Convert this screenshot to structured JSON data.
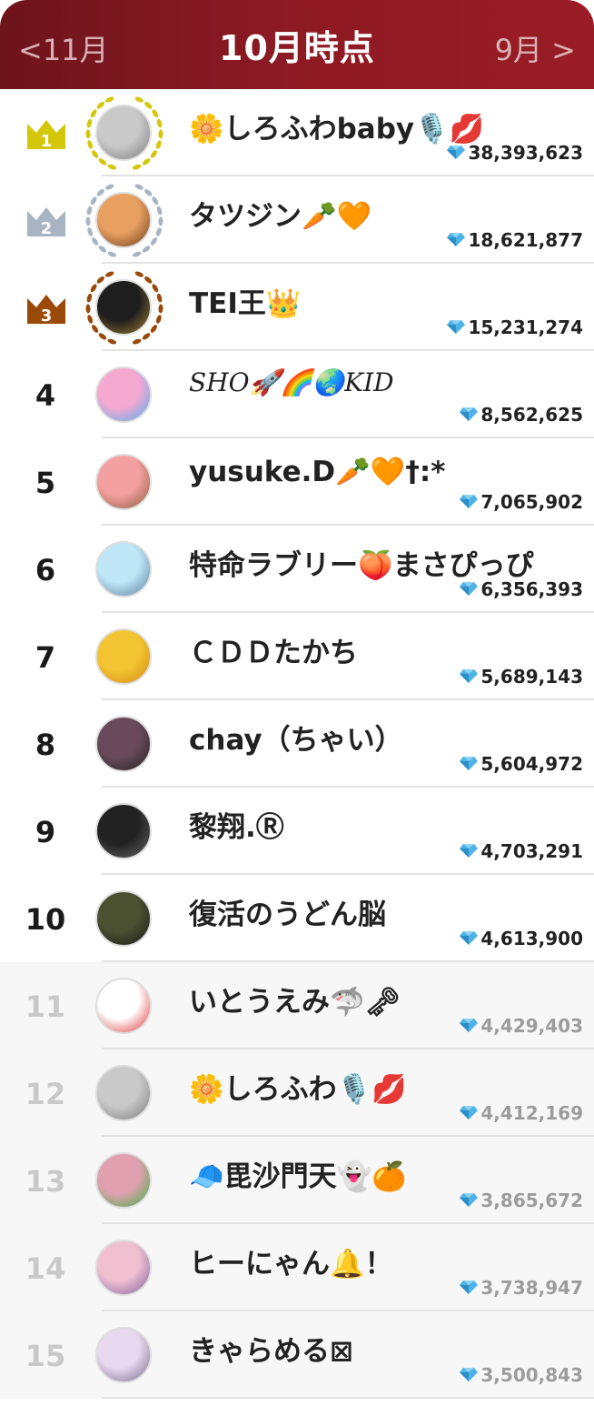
{
  "header": {
    "title": "10月時点",
    "prev_label": "<11月",
    "next_label": "9月 >"
  },
  "colors": {
    "header_bg": "#8e1a24",
    "gold": "#d4c70a",
    "silver": "#a9b4c2",
    "bronze": "#9a4a08",
    "gem": "#4fb2e6"
  },
  "icons": {
    "score": "diamond-icon",
    "rank_badge": "crown-icon"
  },
  "rankings": [
    {
      "rank": "1",
      "name": "🌼しろふわbaby🎙️💋",
      "score": "38,393,623"
    },
    {
      "rank": "2",
      "name": "タツジン🥕🧡",
      "score": "18,621,877"
    },
    {
      "rank": "3",
      "name": "TEI王👑",
      "score": "15,231,274"
    },
    {
      "rank": "4",
      "name": "SHO🚀🌈🌏KID",
      "score": "8,562,625"
    },
    {
      "rank": "5",
      "name": "yusuke.D🥕🧡†:*",
      "score": "7,065,902"
    },
    {
      "rank": "6",
      "name": "特命ラブリー🍑まさぴっぴ",
      "score": "6,356,393"
    },
    {
      "rank": "7",
      "name": "ＣＤＤたかち",
      "score": "5,689,143"
    },
    {
      "rank": "8",
      "name": "chay（ちゃい）",
      "score": "5,604,972"
    },
    {
      "rank": "9",
      "name": "黎翔.Ⓡ",
      "score": "4,703,291"
    },
    {
      "rank": "10",
      "name": "復活のうどん脳",
      "score": "4,613,900"
    },
    {
      "rank": "11",
      "name": "いとうえみ🦈🗝",
      "score": "4,429,403"
    },
    {
      "rank": "12",
      "name": "🌼しろふわ🎙️💋",
      "score": "4,412,169"
    },
    {
      "rank": "13",
      "name": "🧢毘沙門天👻🍊",
      "score": "3,865,672"
    },
    {
      "rank": "14",
      "name": "ヒーにゃん🔔！",
      "score": "3,738,947"
    },
    {
      "rank": "15",
      "name": "きゃらめる⊠",
      "score": "3,500,843"
    }
  ]
}
